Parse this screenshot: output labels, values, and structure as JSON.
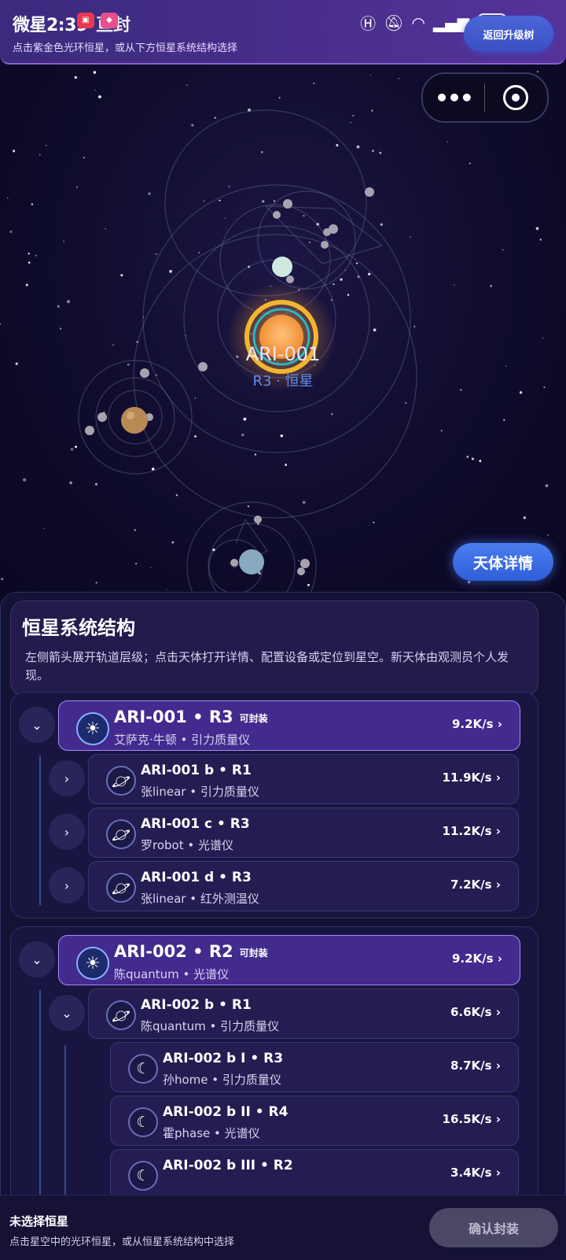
{
  "status": {
    "time": "微星2:39",
    "app_title": "亘封",
    "battery": "87"
  },
  "header": {
    "back_label": "返回升级树",
    "hint": "点击紫金色光环恒星，或从下方恒星系统结构选择"
  },
  "sky": {
    "star_name": "ARI-001",
    "star_sub": "R3 · 恒星",
    "detail_button": "天体详情"
  },
  "panel": {
    "title": "恒星系统结构",
    "desc": "左侧箭头展开轨道层级；点击天体打开详情、配置设备或定位到星空。新天体由观测员个人发现。",
    "groups": [
      {
        "star": {
          "name": "ARI-001 • R3",
          "tag": "可封装",
          "sub": "艾萨克·牛顿 • 引力质量仪",
          "rate": "9.2K/s ›"
        },
        "children": [
          {
            "name": "ARI-001 b • R1",
            "sub": "张linear • 引力质量仪",
            "rate": "11.9K/s ›"
          },
          {
            "name": "ARI-001 c • R3",
            "sub": "罗robot • 光谱仪",
            "rate": "11.2K/s ›"
          },
          {
            "name": "ARI-001 d • R3",
            "sub": "张linear • 红外测温仪",
            "rate": "7.2K/s ›"
          }
        ]
      },
      {
        "star": {
          "name": "ARI-002 • R2",
          "tag": "可封装",
          "sub": "陈quantum • 光谱仪",
          "rate": "9.2K/s ›"
        },
        "planet": {
          "name": "ARI-002 b • R1",
          "sub": "陈quantum • 引力质量仪",
          "rate": "6.6K/s ›"
        },
        "moons": [
          {
            "name": "ARI-002 b I • R3",
            "sub": "孙home • 引力质量仪",
            "rate": "8.7K/s ›"
          },
          {
            "name": "ARI-002 b II • R4",
            "sub": "霍phase • 光谱仪",
            "rate": "16.5K/s ›"
          },
          {
            "name": "ARI-002 b III • R2",
            "sub": "",
            "rate": "3.4K/s ›"
          }
        ]
      }
    ]
  },
  "footer": {
    "status": "未选择恒星",
    "hint": "点击星空中的光环恒星，或从恒星系统结构中选择",
    "confirm": "确认封装"
  },
  "icons": {
    "star": "sun-icon",
    "planet": "planet-icon",
    "moon": "moon-icon",
    "collapse": "chevron-down-icon",
    "expand": "chevron-right-icon"
  }
}
